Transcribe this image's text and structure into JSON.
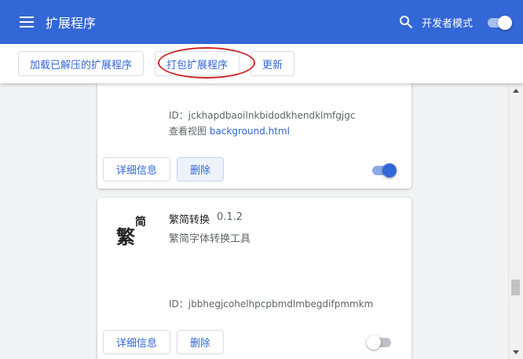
{
  "header": {
    "title": "扩展程序",
    "menu_icon": "hamburger-menu-icon",
    "search_icon": "search-icon",
    "dev_mode_label": "开发者模式",
    "dev_mode_on": true,
    "color": "#3367d6"
  },
  "toolbar": {
    "load_unpacked": "加载已解压的扩展程序",
    "pack_extension": "打包扩展程序",
    "update": "更新",
    "highlight_color": "#d0282c"
  },
  "extensions": [
    {
      "id": "ID：jckhapdbaoilnkbidodkhendklmfgjgc",
      "views_label": "查看视图",
      "views_link": "background.html",
      "details_label": "详细信息",
      "remove_label": "删除",
      "enabled": true
    },
    {
      "logo_main": "繁",
      "logo_sub": "简",
      "name": "繁简转换",
      "version": "0.1.2",
      "description": "繁简字体转换工具",
      "id": "ID：jbbhegjcohelhpcpbmdlmbegdifpmmkm",
      "details_label": "详细信息",
      "remove_label": "删除",
      "enabled": false
    }
  ],
  "scrollbar": {
    "up_icon": "scroll-up-arrow-icon",
    "down_icon": "scroll-down-arrow-icon"
  }
}
